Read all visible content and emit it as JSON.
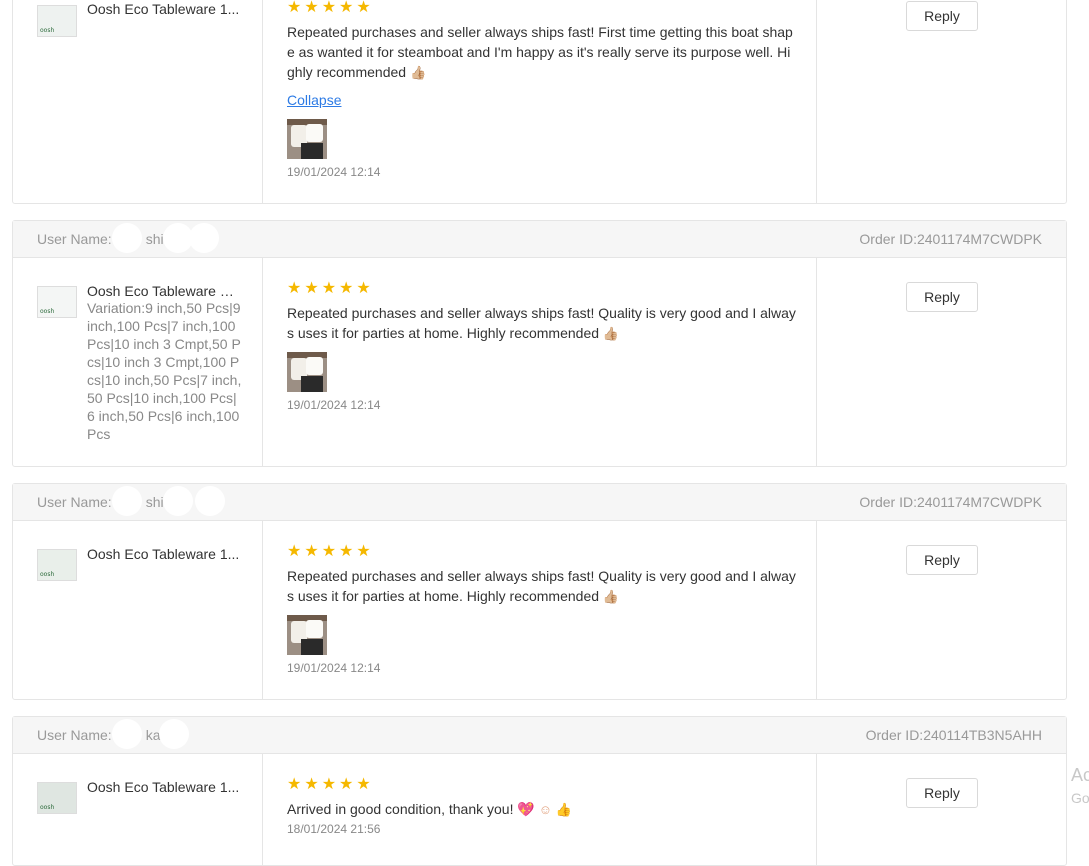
{
  "reviews": [
    {
      "product_name": "Oosh Eco Tableware 1...",
      "stars": "★★★★★",
      "text": "Repeated purchases and seller always ships fast! First time getting this boat shape as wanted it for steamboat and I'm happy as it's really serve its purpose well. Highly recommended",
      "emoji": "👍🏼",
      "collapse_label": "Collapse",
      "date": "19/01/2024 12:14",
      "reply_label": "Reply"
    },
    {
      "user_label": "User Name:",
      "user_name": "shi",
      "order_id": "Order ID:2401174M7CWDPK",
      "product_name": "Oosh Eco Tableware Pl...",
      "variation": "Variation:9 inch,50 Pcs|9 inch,100 Pcs|7 inch,100 Pcs|10 inch 3 Cmpt,50 Pcs|10 inch 3 Cmpt,100 Pcs|10 inch,50 Pcs|7 inch,50 Pcs|10 inch,100 Pcs|6 inch,50 Pcs|6 inch,100 Pcs",
      "stars": "★★★★★",
      "text": "Repeated purchases and seller always ships fast! Quality is very good and I always uses it for parties at home. Highly recommended",
      "emoji": "👍🏼",
      "date": "19/01/2024 12:14",
      "reply_label": "Reply"
    },
    {
      "user_label": "User Name:",
      "user_name": "shi",
      "order_id": "Order ID:2401174M7CWDPK",
      "product_name": "Oosh Eco Tableware 1...",
      "stars": "★★★★★",
      "text": "Repeated purchases and seller always ships fast! Quality is very good and I always uses it for parties at home. Highly recommended",
      "emoji": "👍🏼",
      "date": "19/01/2024 12:14",
      "reply_label": "Reply"
    },
    {
      "user_label": "User Name:",
      "user_name": "ka",
      "order_id": "Order ID:240114TB3N5AHH",
      "product_name": "Oosh Eco Tableware 1...",
      "stars": "★★★★★",
      "text": "Arrived in good condition, thank you!",
      "emoji_heart": "💖",
      "emoji_rest": "☺ 👍",
      "date": "18/01/2024 21:56",
      "reply_label": "Reply"
    }
  ],
  "brand_text": "oosh",
  "side_text": [
    "Ac",
    "Go"
  ]
}
